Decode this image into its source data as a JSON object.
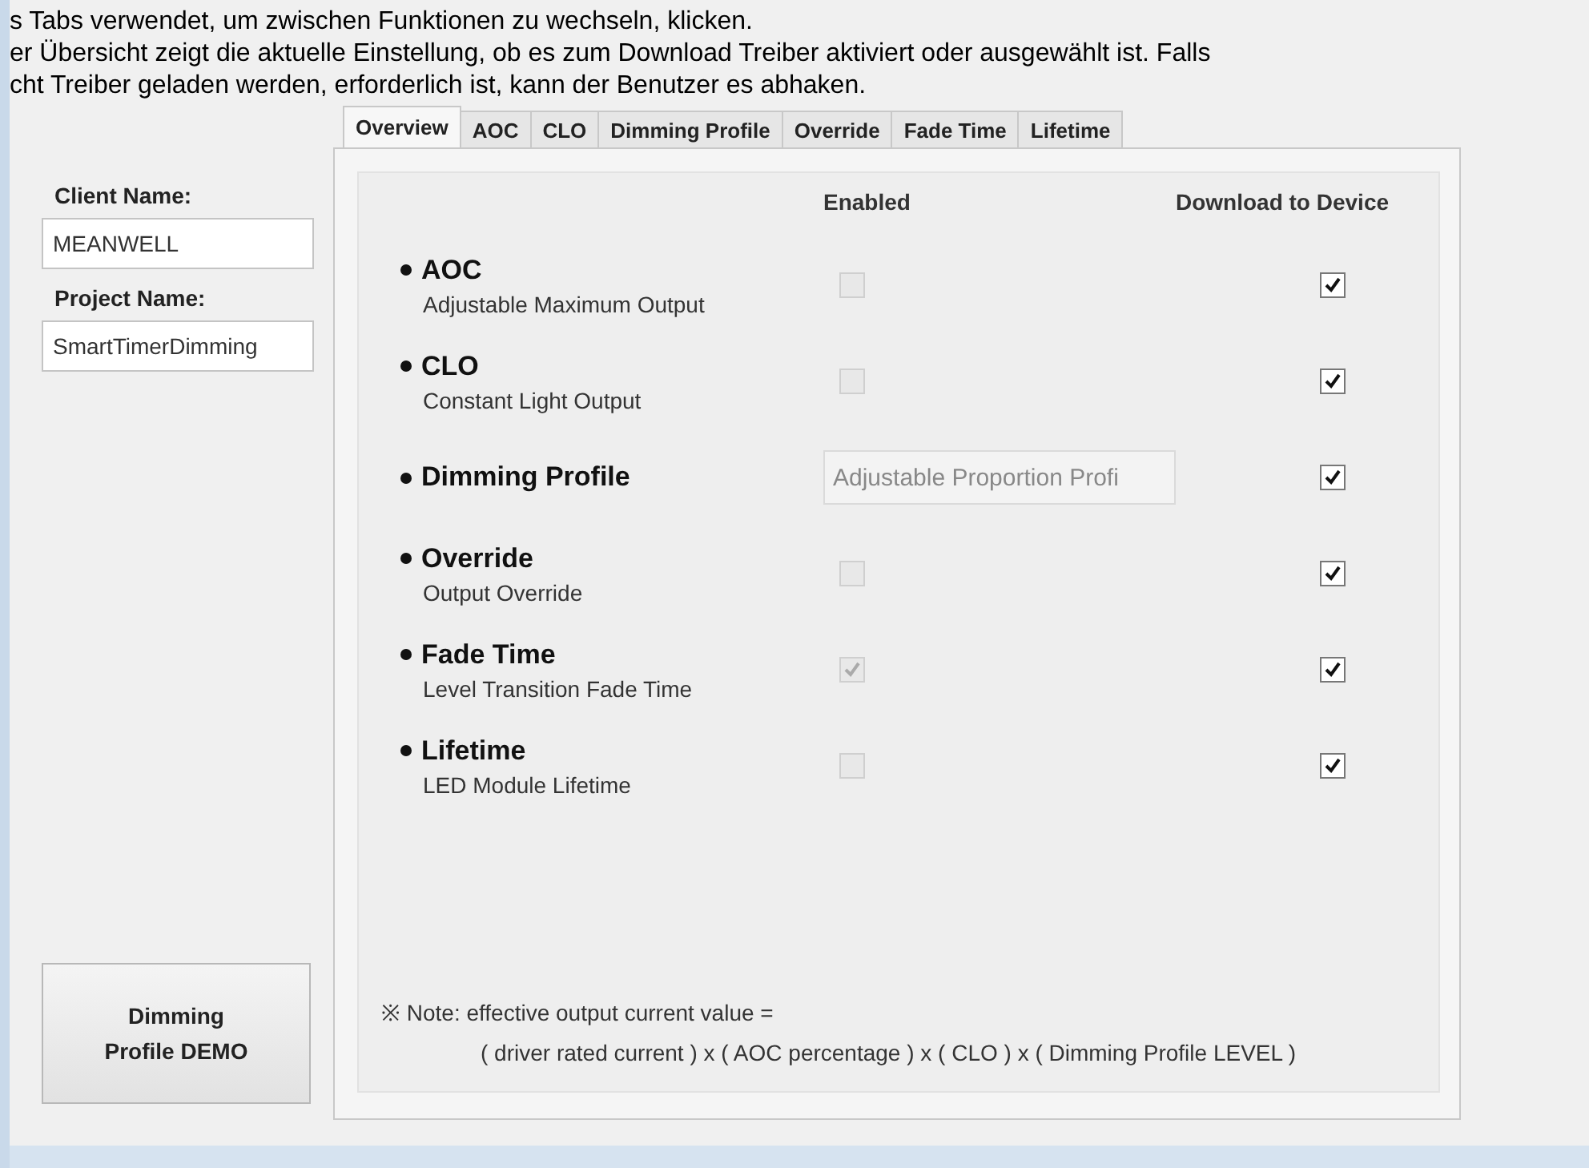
{
  "sidebar": {
    "client_label": "Client Name:",
    "client_value": "MEANWELL",
    "project_label": "Project Name:",
    "project_value": "SmartTimerDimming",
    "demo_button": "Dimming Profile DEMO"
  },
  "tabs": [
    {
      "label": "Overview",
      "selected": true
    },
    {
      "label": "AOC",
      "selected": false
    },
    {
      "label": "CLO",
      "selected": false
    },
    {
      "label": "Dimming Profile",
      "selected": false
    },
    {
      "label": "Override",
      "selected": false
    },
    {
      "label": "Fade Time",
      "selected": false
    },
    {
      "label": "Lifetime",
      "selected": false
    }
  ],
  "columns": [
    "Enabled",
    "Download to Device"
  ],
  "features": [
    {
      "title": "AOC",
      "subtitle": "Adjustable Maximum Output",
      "enabled": {
        "kind": "checkbox",
        "checked": false
      },
      "download": true
    },
    {
      "title": "CLO",
      "subtitle": "Constant Light Output",
      "enabled": {
        "kind": "checkbox",
        "checked": false
      },
      "download": true
    },
    {
      "title": "Dimming Profile",
      "enabled": {
        "kind": "field",
        "value": "Adjustable Proportion Profi"
      },
      "download": true
    },
    {
      "title": "Override",
      "subtitle": "Output Override",
      "enabled": {
        "kind": "checkbox",
        "checked": false
      },
      "download": true
    },
    {
      "title": "Fade Time",
      "subtitle": "Level Transition Fade Time",
      "enabled": {
        "kind": "checkbox",
        "checked": true
      },
      "download": true
    },
    {
      "title": "Lifetime",
      "subtitle": "LED Module Lifetime",
      "enabled": {
        "kind": "checkbox",
        "checked": false
      },
      "download": true
    }
  ],
  "note": {
    "mark": "※",
    "line_1": "Note: effective output current value =",
    "line_2": "( driver rated current ) x ( AOC percentage ) x ( CLO ) x ( Dimming Profile LEVEL )"
  },
  "caption_overlay": [
    "s Tabs verwendet, um zwischen Funktionen zu wechseln, klicken.",
    "er Übersicht zeigt die aktuelle Einstellung, ob es zum Download Treiber aktiviert oder ausgewählt ist. Falls",
    "cht Treiber geladen werden, erforderlich ist, kann der Benutzer es abhaken."
  ]
}
